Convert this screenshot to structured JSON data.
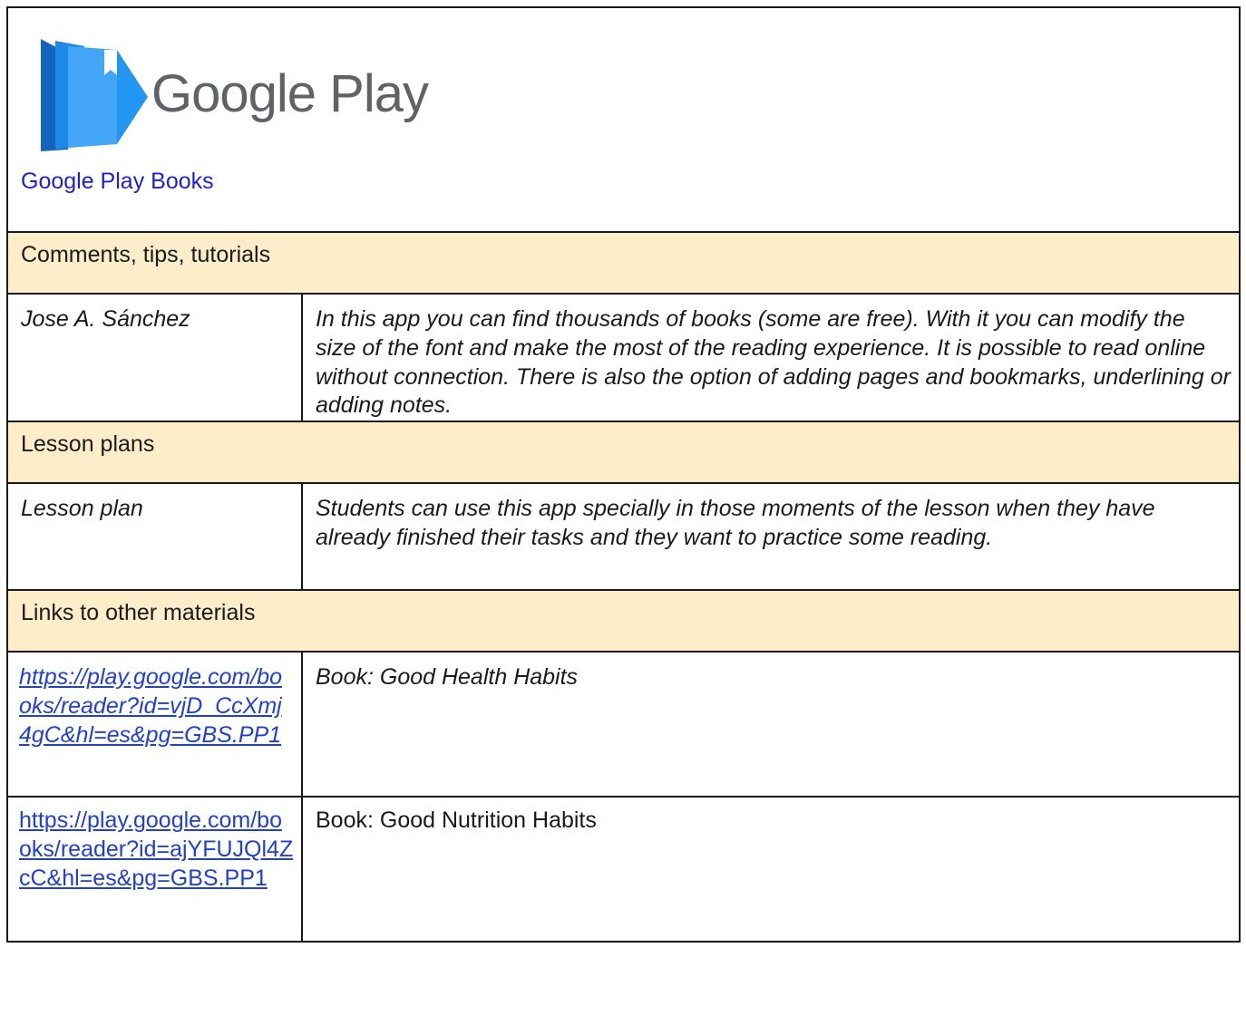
{
  "header": {
    "logo_alt": "Google Play",
    "logo_word": "Google Play",
    "app_name": "Google Play Books",
    "icon": "google-play-books-logo"
  },
  "sections": {
    "comments_title": "Comments, tips, tutorials",
    "lesson_title": "Lesson plans",
    "links_title": "Links to other materials"
  },
  "comments": [
    {
      "author": "Jose A. Sánchez",
      "text": "In this app you can find thousands of books (some are free). With it you can modify the size of the font and make the most of the reading experience. It is possible to read online without connection. There is also the option of adding pages and bookmarks, underlining or adding notes."
    }
  ],
  "lessons": [
    {
      "label": "Lesson plan",
      "text": "Students can use this app specially in those moments of the lesson when they have already finished their tasks and they want to practice some reading."
    }
  ],
  "links": [
    {
      "url": "https://play.google.com/books/reader?id=vjD_CcXmj4gC&hl=es&pg=GBS.PP1",
      "description": "Book: Good Health Habits"
    },
    {
      "url": "https://play.google.com/books/reader?id=ajYFUJQl4ZcC&hl=es&pg=GBS.PP1",
      "description": "Book: Good Nutrition Habits"
    }
  ],
  "colors": {
    "section_bg": "#fdeec9",
    "link": "#1f1fd6",
    "border": "#1a1a1a"
  }
}
